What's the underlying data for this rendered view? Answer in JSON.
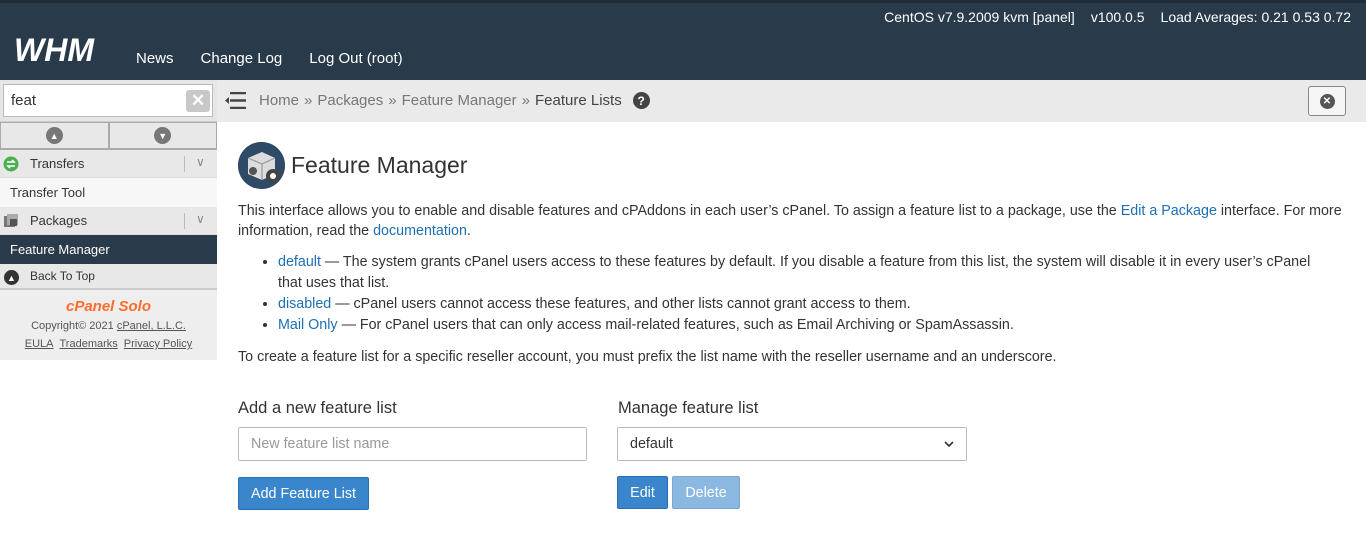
{
  "system": {
    "os": "CentOS v7.9.2009 kvm [panel]",
    "version": "v100.0.5",
    "load": "Load Averages: 0.21 0.53 0.72"
  },
  "nav": {
    "news": "News",
    "changelog": "Change Log",
    "logout": "Log Out (root)"
  },
  "sidebar": {
    "search_value": "feat",
    "categories": [
      {
        "label": "Transfers",
        "items": [
          "Transfer Tool"
        ]
      },
      {
        "label": "Packages",
        "items": [
          "Feature Manager"
        ]
      }
    ],
    "back_to_top": "Back To Top",
    "footer": {
      "brand": "cPanel Solo",
      "copyright": "Copyright© 2021",
      "company": "cPanel, L.L.C.",
      "eula": "EULA",
      "trademarks": "Trademarks",
      "privacy": "Privacy Policy"
    }
  },
  "breadcrumb": {
    "home": "Home",
    "packages": "Packages",
    "feature_manager": "Feature Manager",
    "current": "Feature Lists",
    "sep": "»"
  },
  "page": {
    "title": "Feature Manager",
    "intro_a": "This interface allows you to enable and disable features and cPAddons in each user’s cPanel. To assign a feature list to a package, use the ",
    "intro_link1": "Edit a Package",
    "intro_b": " interface. For more information, read the ",
    "intro_link2": "documentation",
    "intro_c": ".",
    "bullets": [
      {
        "link": "default",
        "text": " — The system grants cPanel users access to these features by default. If you disable a feature from this list, the system will disable it in every user’s cPanel that uses that list."
      },
      {
        "link": "disabled",
        "text": " — cPanel users cannot access these features, and other lists cannot grant access to them."
      },
      {
        "link": "Mail Only",
        "text": " — For cPanel users that can only access mail-related features, such as Email Archiving or SpamAssassin."
      }
    ],
    "note": "To create a feature list for a specific reseller account, you must prefix the list name with the reseller username and an underscore."
  },
  "form": {
    "add_label": "Add a new feature list",
    "add_placeholder": "New feature list name",
    "add_button": "Add Feature List",
    "manage_label": "Manage feature list",
    "manage_selected": "default",
    "edit_button": "Edit",
    "delete_button": "Delete"
  },
  "colors": {
    "header": "#293a4a",
    "link": "#1d6fb5",
    "primary_button": "#3a86cc",
    "accent": "#ff6c2c"
  }
}
